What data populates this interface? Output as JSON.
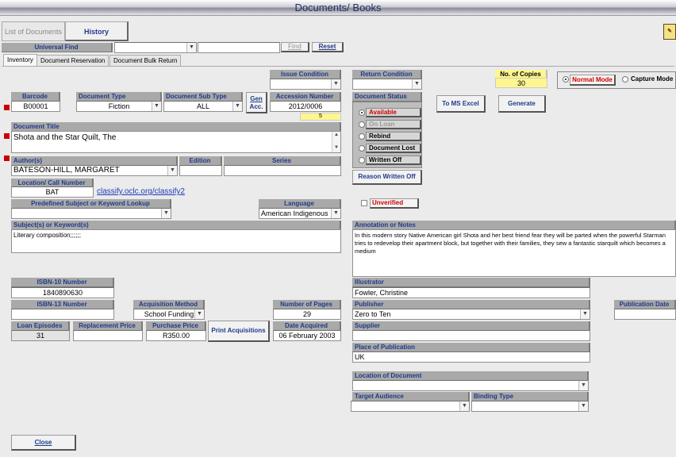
{
  "window": {
    "title": "Documents/ Books"
  },
  "top_buttons": {
    "list_of_documents": "List of Documents",
    "history": "History"
  },
  "universal_find": {
    "label": "Universal Find",
    "value": "",
    "find_button": "Find",
    "reset_button": "Reset"
  },
  "tabs": [
    "Inventory",
    "Document Reservation",
    "Document Bulk Return"
  ],
  "issue_condition": {
    "label": "Issue Condition",
    "value": ""
  },
  "return_condition": {
    "label": "Return Condition",
    "value": ""
  },
  "copies": {
    "label": "No. of Copies",
    "value": "30"
  },
  "mode": {
    "normal": "Normal Mode",
    "capture": "Capture Mode",
    "selected": "normal"
  },
  "barcode": {
    "label": "Barcode",
    "value": "B00001"
  },
  "document_type": {
    "label": "Document Type",
    "value": "Fiction"
  },
  "document_sub_type": {
    "label": "Document Sub Type",
    "value": "ALL"
  },
  "gen_acc": {
    "line1": "Gen",
    "line2": "Acc."
  },
  "accession": {
    "label": "Accession Number",
    "value": "2012/0006",
    "count": "5"
  },
  "document_status": {
    "label": "Document Status",
    "options": [
      "Available",
      "On Loan",
      "Rebind",
      "Document Lost",
      "Written Off"
    ],
    "selected": "Available"
  },
  "reason_written_off": "Reason Written Off",
  "to_ms_excel": "To MS Excel",
  "generate": "Generate",
  "document_title": {
    "label": "Document Title",
    "value": "Shota and the Star Quilt, The"
  },
  "authors": {
    "label": "Author(s)",
    "value": "BATESON-HILL, MARGARET"
  },
  "edition": {
    "label": "Edition",
    "value": ""
  },
  "series": {
    "label": "Series",
    "value": ""
  },
  "location": {
    "label": "Location/ Call Number",
    "value": "BAT",
    "link": "classify.oclc.org/classify2"
  },
  "unverified": "Unverified",
  "predefined_subject": {
    "label": "Predefined Subject or Keyword Lookup",
    "value": ""
  },
  "language": {
    "label": "Language",
    "value": "American Indigenous"
  },
  "subjects": {
    "label": "Subject(s) or Keyword(s)",
    "value": "Literary composition;;;;;;"
  },
  "annotation": {
    "label": "Annotation or Notes",
    "value": "In this modern story Native American girl Shota and her best friend fear they will be parted when the powerful Starman tries to redevelop their apartment block, but together with their families, they sew a fantastic starquilt which becomes a medium"
  },
  "isbn10": {
    "label": "ISBN-10 Number",
    "value": "1840890630"
  },
  "isbn13": {
    "label": "ISBN-13 Number",
    "value": ""
  },
  "acquisition_method": {
    "label": "Acquisition Method",
    "value": "School Funding"
  },
  "number_of_pages": {
    "label": "Number of Pages",
    "value": "29"
  },
  "loan_episodes": {
    "label": "Loan Episodes",
    "value": "31"
  },
  "replacement_price": {
    "label": "Replacement Price",
    "value": ""
  },
  "purchase_price": {
    "label": "Purchase Price",
    "value": "R350.00"
  },
  "print_acquisitions": "Print Acquisitions",
  "date_acquired": {
    "label": "Date Acquired",
    "value": "06 February 2003"
  },
  "illustrator": {
    "label": "Illustrator",
    "value": "Fowler, Christine"
  },
  "publisher": {
    "label": "Publisher",
    "value": "Zero to Ten"
  },
  "publication_date": {
    "label": "Publication Date",
    "value": ""
  },
  "supplier": {
    "label": "Supplier",
    "value": ""
  },
  "place_of_publication": {
    "label": "Place of Publication",
    "value": "UK"
  },
  "location_of_document": {
    "label": "Location of Document",
    "value": ""
  },
  "target_audience": {
    "label": "Target Audience",
    "value": ""
  },
  "binding_type": {
    "label": "Binding Type",
    "value": ""
  },
  "close": "Close",
  "colors": {
    "label_bg": "#a9a9a9",
    "label_text": "#1f3b8a",
    "required_marker": "#cc0000",
    "highlight": "#fff68f"
  }
}
